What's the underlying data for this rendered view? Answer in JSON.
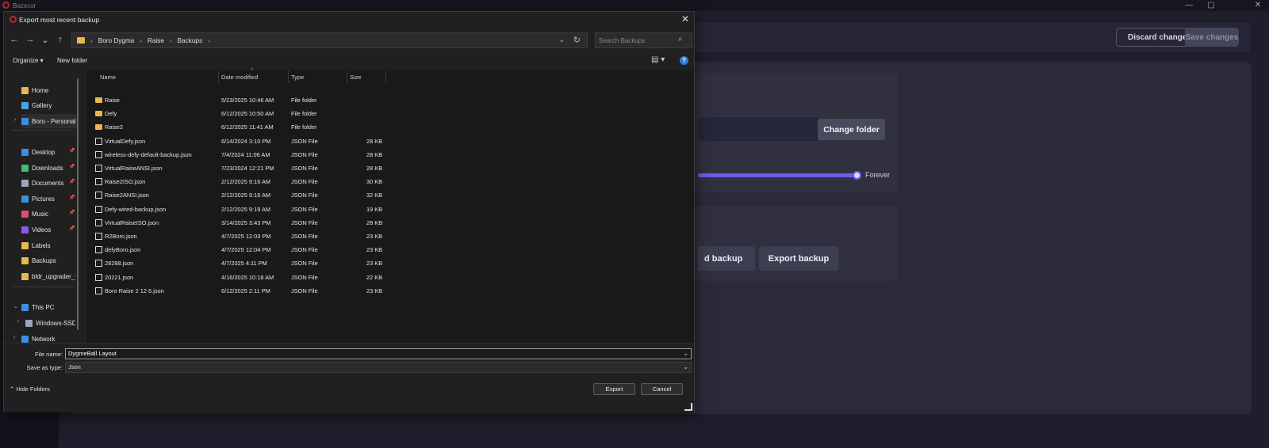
{
  "app": {
    "title": "Bazecor",
    "discard_label": "Discard changes",
    "save_label": "Save changes",
    "change_folder_label": "Change folder",
    "slider_value_label": "Forever",
    "load_backup_label": "d backup",
    "export_backup_label": "Export backup",
    "win_min": "—",
    "win_max": "▢",
    "win_close": "✕"
  },
  "dialog": {
    "title": "Export most recent backup",
    "close": "✕",
    "nav": {
      "back": "←",
      "forward": "→",
      "recent": "⌄",
      "up": "↑"
    },
    "breadcrumbs": [
      "Boro Dygma",
      "Raise",
      "Backups"
    ],
    "breadcrumb_sep": "›",
    "search_placeholder": "Search Backups",
    "toolbar": {
      "organize": "Organize ▾",
      "new_folder": "New folder",
      "view": "▤ ▾",
      "help": "?"
    },
    "nav_items": [
      {
        "label": "Home",
        "icon": "home-icon",
        "color": "#e8b84a"
      },
      {
        "label": "Gallery",
        "icon": "gallery-icon",
        "color": "#4aa3e8"
      },
      {
        "label": "Boro - Personal",
        "icon": "cloud-icon",
        "color": "#3b8fe0"
      },
      {
        "label": "Desktop",
        "icon": "desktop-icon",
        "color": "#3b8fe0"
      },
      {
        "label": "Downloads",
        "icon": "download-icon",
        "color": "#3fbf6a"
      },
      {
        "label": "Documents",
        "icon": "documents-icon",
        "color": "#9aa6b8"
      },
      {
        "label": "Pictures",
        "icon": "pictures-icon",
        "color": "#3b8fe0"
      },
      {
        "label": "Music",
        "icon": "music-icon",
        "color": "#e0506c"
      },
      {
        "label": "Videos",
        "icon": "videos-icon",
        "color": "#8a5ce0"
      },
      {
        "label": "Labels",
        "icon": "folder-icon",
        "color": "#e8b84a"
      },
      {
        "label": "Backups",
        "icon": "folder-icon",
        "color": "#e8b84a"
      },
      {
        "label": "bldr_upgrader_v",
        "icon": "folder-icon",
        "color": "#e8b84a"
      },
      {
        "label": "This PC",
        "icon": "pc-icon",
        "color": "#3b8fe0"
      },
      {
        "label": "Windows-SSD",
        "icon": "drive-icon",
        "color": "#9aa6b8"
      },
      {
        "label": "Network",
        "icon": "network-icon",
        "color": "#3b8fe0"
      }
    ],
    "columns": [
      "Name",
      "Date modified",
      "Type",
      "Size"
    ],
    "files": [
      {
        "name": "Raise",
        "date": "5/23/2025 10:46 AM",
        "type": "File folder",
        "size": "",
        "kind": "folder"
      },
      {
        "name": "Defy",
        "date": "6/12/2025 10:50 AM",
        "type": "File folder",
        "size": "",
        "kind": "folder"
      },
      {
        "name": "Raise2",
        "date": "6/12/2025 11:41 AM",
        "type": "File folder",
        "size": "",
        "kind": "folder"
      },
      {
        "name": "VirtualDefy.json",
        "date": "6/14/2024 3:10 PM",
        "type": "JSON File",
        "size": "28 KB",
        "kind": "file"
      },
      {
        "name": "wireless-defy-default-backup.json",
        "date": "7/4/2024 11:06 AM",
        "type": "JSON File",
        "size": "28 KB",
        "kind": "file"
      },
      {
        "name": "VirtualRaiseANSI.json",
        "date": "7/23/2024 12:21 PM",
        "type": "JSON File",
        "size": "28 KB",
        "kind": "file"
      },
      {
        "name": "Raise2ISO.json",
        "date": "2/12/2025 9:16 AM",
        "type": "JSON File",
        "size": "30 KB",
        "kind": "file"
      },
      {
        "name": "Raise2ANSI.json",
        "date": "2/12/2025 9:16 AM",
        "type": "JSON File",
        "size": "32 KB",
        "kind": "file"
      },
      {
        "name": "Defy-wired-backup.json",
        "date": "2/12/2025 9:19 AM",
        "type": "JSON File",
        "size": "19 KB",
        "kind": "file"
      },
      {
        "name": "VirtualRaiseISO.json",
        "date": "3/14/2025 3:43 PM",
        "type": "JSON File",
        "size": "28 KB",
        "kind": "file"
      },
      {
        "name": "R2Boro.json",
        "date": "4/7/2025 12:03 PM",
        "type": "JSON File",
        "size": "23 KB",
        "kind": "file"
      },
      {
        "name": "defyBoro.json",
        "date": "4/7/2025 12:04 PM",
        "type": "JSON File",
        "size": "23 KB",
        "kind": "file"
      },
      {
        "name": "28288.json",
        "date": "4/7/2025 4:11 PM",
        "type": "JSON File",
        "size": "23 KB",
        "kind": "file"
      },
      {
        "name": "20221.json",
        "date": "4/16/2025 10:18 AM",
        "type": "JSON File",
        "size": "22 KB",
        "kind": "file"
      },
      {
        "name": "Boro Raise 2 12 6.json",
        "date": "6/12/2025 2:11 PM",
        "type": "JSON File",
        "size": "23 KB",
        "kind": "file"
      }
    ],
    "file_name_label": "File name:",
    "file_name_value": "DygmeBall Layout",
    "save_type_label": "Save as type:",
    "save_type_value": "Json",
    "hide_folders_label": "Hide Folders",
    "export_label": "Export",
    "cancel_label": "Cancel"
  }
}
